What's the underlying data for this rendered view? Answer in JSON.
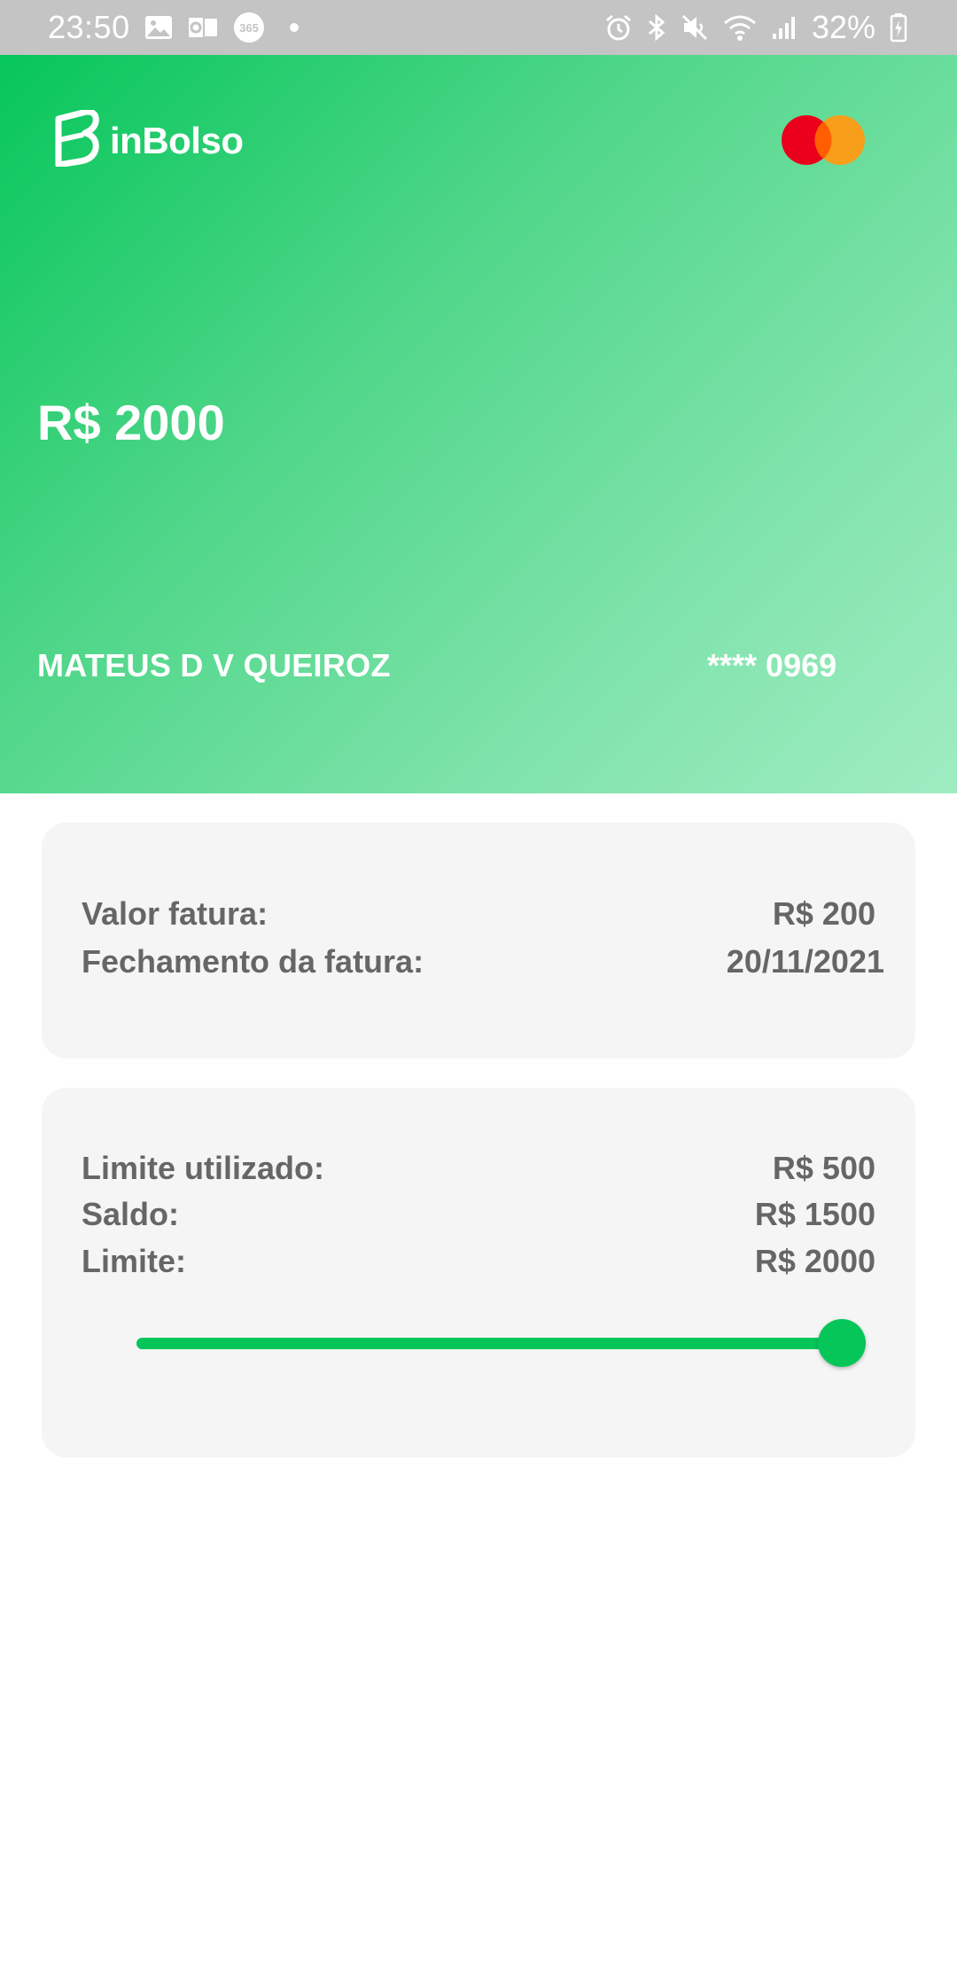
{
  "status_bar": {
    "time": "23:50",
    "battery": "32%",
    "left_icons": [
      "gallery-icon",
      "outlook-icon",
      "office365-icon"
    ],
    "right_icons": [
      "alarm-icon",
      "bluetooth-icon",
      "mute-icon",
      "wifi-icon",
      "signal-icon",
      "battery-icon"
    ]
  },
  "card": {
    "brand": "inBolso",
    "network": "mastercard",
    "balance": "R$ 2000",
    "holder": "MATEUS D V QUEIROZ",
    "number": "**** 0969",
    "colors": {
      "gradient_start": "#06c65a",
      "gradient_end": "#a0ecc2"
    }
  },
  "invoice": {
    "value_label": "Valor fatura:",
    "value": "R$ 200",
    "closing_label": "Fechamento da fatura:",
    "closing_date": "20/11/2021"
  },
  "limit": {
    "used_label": "Limite utilizado:",
    "used": "R$ 500",
    "balance_label": "Saldo:",
    "balance": "R$ 1500",
    "limit_label": "Limite:",
    "limit": "R$ 2000",
    "slider_fraction": 1.0,
    "accent": "#06c65a"
  }
}
